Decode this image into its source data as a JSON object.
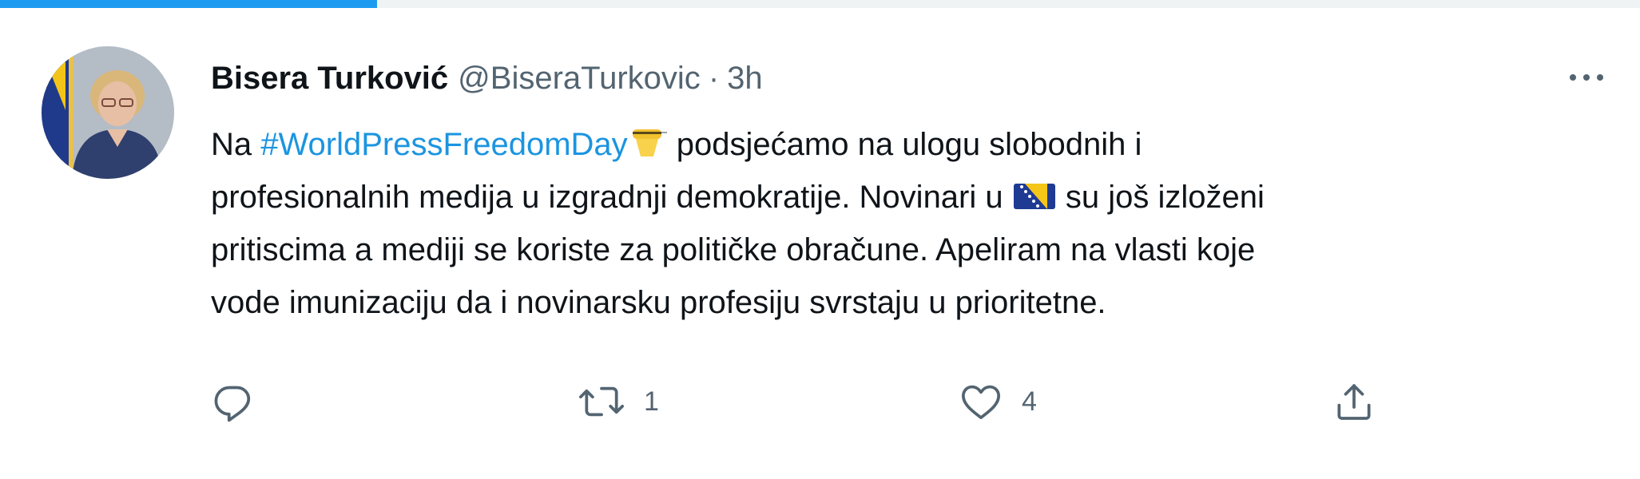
{
  "progress": {
    "fraction": 0.23,
    "color": "#1d9bf0"
  },
  "tweet": {
    "author": {
      "display_name": "Bisera Turković",
      "handle": "@BiseraTurkovic",
      "separator": "·",
      "time": "3h",
      "avatar_icon": "profile-photo"
    },
    "more_icon": "more-horizontal-icon",
    "body": {
      "line1_before": "Na ",
      "hashtag": "#WorldPressFreedomDay",
      "emoji_1": "microphone-emoji",
      "line1_after": " podsjećamo na ulogu slobodnih i",
      "line2_before": "profesionalnih medija u izgradnji demokratije. Novinari u ",
      "emoji_2": "bosnia-herzegovina-flag-emoji",
      "line2_after": " su još izloženi",
      "line3": "pritiscima a mediji se koriste za političke obračune. Apeliram na vlasti koje",
      "line4": "vode imunizaciju da i novinarsku profesiju svrstaju u prioritetne."
    },
    "actions": {
      "reply": {
        "icon": "reply-icon",
        "count": ""
      },
      "retweet": {
        "icon": "retweet-icon",
        "count": "1"
      },
      "like": {
        "icon": "heart-icon",
        "count": "4"
      },
      "share": {
        "icon": "share-icon",
        "count": ""
      }
    },
    "colors": {
      "text": "#0f1419",
      "secondary": "#536471",
      "link": "#1b95e0"
    }
  }
}
